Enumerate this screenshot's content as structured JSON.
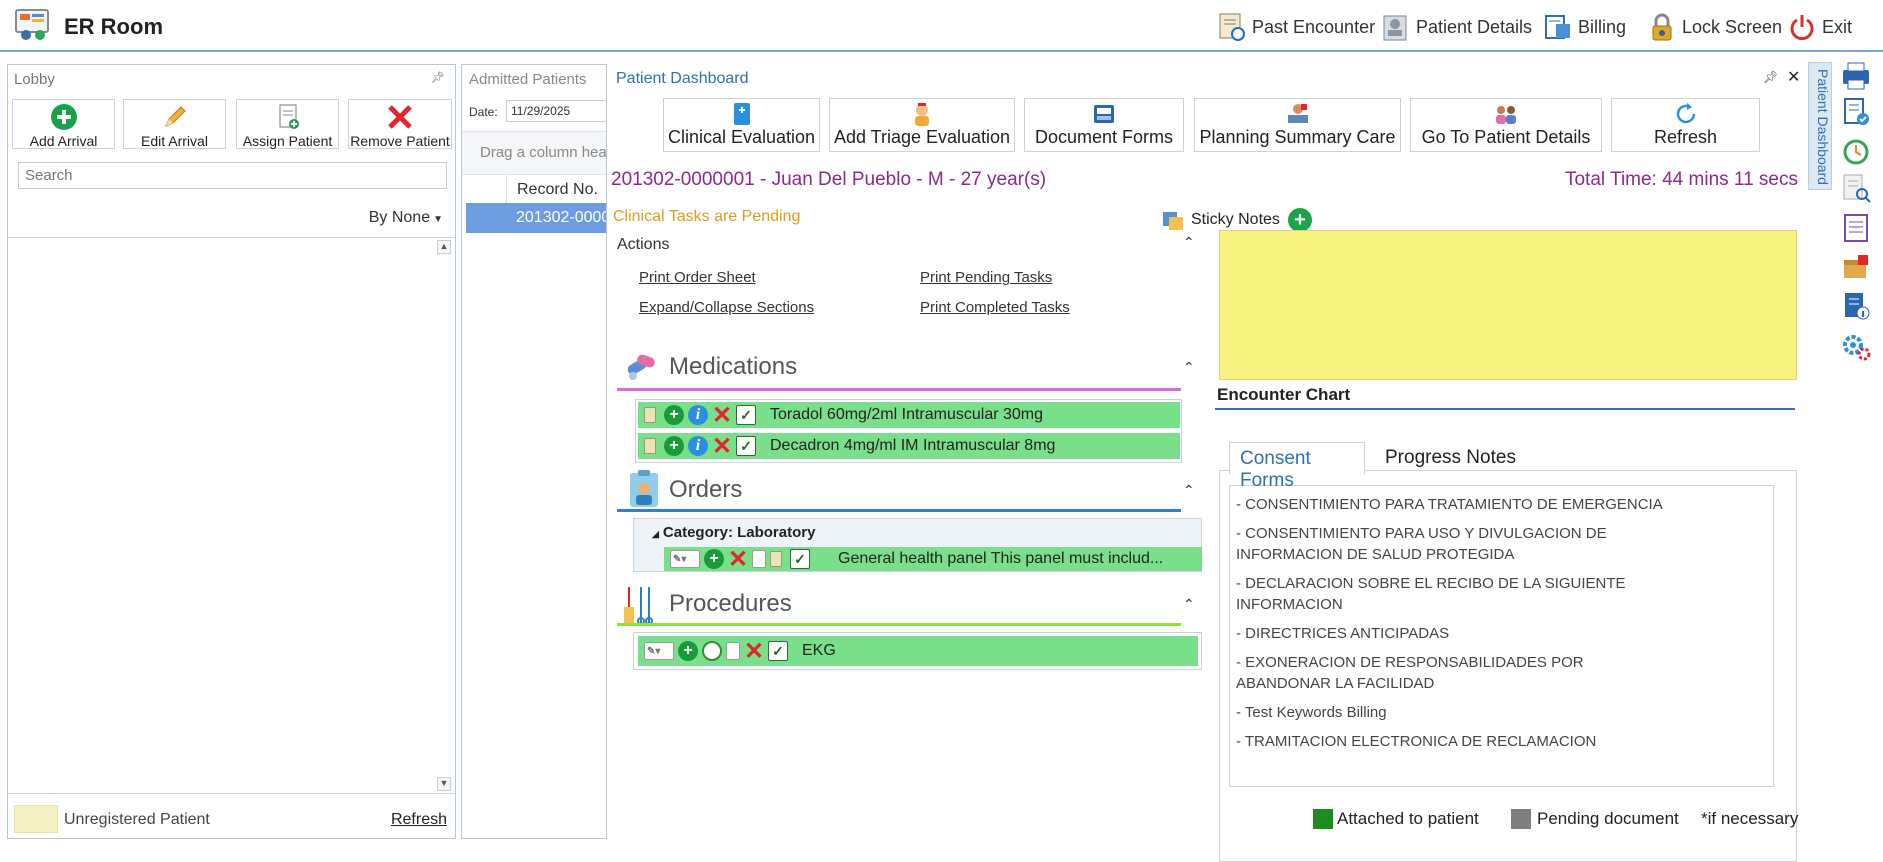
{
  "app": {
    "title": "ER Room"
  },
  "topbar": {
    "past_encounter": "Past Encounter",
    "patient_details": "Patient Details",
    "billing": "Billing",
    "lock_screen": "Lock Screen",
    "exit": "Exit"
  },
  "lobby": {
    "title": "Lobby",
    "add_arrival": "Add Arrival",
    "edit_arrival": "Edit Arrival",
    "assign_patient": "Assign Patient",
    "remove_patient": "Remove Patient",
    "search_placeholder": "Search",
    "sort_label": "By None",
    "legend_label": "Unregistered Patient",
    "refresh": "Refresh"
  },
  "admitted": {
    "title": "Admitted Patients",
    "date_label": "Date:",
    "date_value": "11/29/2025",
    "drag_hint": "Drag a column hea",
    "col_record": "Record No.",
    "row_record": "201302-0000"
  },
  "dashboard": {
    "title": "Patient Dashboard",
    "toolbar": {
      "clinical_evaluation": "Clinical Evaluation",
      "add_triage": "Add Triage Evaluation",
      "document_forms": "Document Forms",
      "planning_summary": "Planning Summary Care",
      "goto_patient": "Go To Patient Details",
      "refresh": "Refresh"
    },
    "patient_banner": "201302-0000001 - Juan Del Pueblo - M - 27 year(s)",
    "total_time": "Total Time: 44 mins 11 secs",
    "pending_message": "Clinical Tasks are Pending",
    "actions": {
      "title": "Actions",
      "print_order_sheet": "Print Order Sheet",
      "print_pending_tasks": "Print Pending Tasks",
      "expand_collapse": "Expand/Collapse Sections",
      "print_completed_tasks": "Print Completed Tasks"
    },
    "medications": {
      "title": "Medications",
      "items": [
        {
          "text": "Toradol 60mg/2ml  Intramuscular  30mg"
        },
        {
          "text": "Decadron 4mg/ml IM  Intramuscular  8mg"
        }
      ]
    },
    "orders": {
      "title": "Orders",
      "category": "Category: Laboratory",
      "items": [
        {
          "text": "General health panel This panel must includ..."
        }
      ]
    },
    "procedures": {
      "title": "Procedures",
      "items": [
        {
          "text": "EKG"
        }
      ]
    },
    "sticky_notes": {
      "label": "Sticky Notes"
    },
    "encounter_chart": {
      "title": "Encounter Chart",
      "tab_consent": "Consent Forms",
      "tab_progress": "Progress Notes",
      "consent_items": [
        "- CONSENTIMIENTO PARA TRATAMIENTO DE EMERGENCIA",
        "- CONSENTIMIENTO PARA USO Y DIVULGACION DE INFORMACION DE SALUD PROTEGIDA",
        "- DECLARACION SOBRE EL RECIBO DE LA SIGUIENTE INFORMACION",
        "- DIRECTRICES ANTICIPADAS",
        "- EXONERACION DE RESPONSABILIDADES POR ABANDONAR LA FACILIDAD",
        "- Test Keywords Billing",
        "- TRAMITACION ELECTRONICA DE RECLAMACION"
      ]
    },
    "legend": {
      "attached": "Attached to patient",
      "pending": "Pending document",
      "if_necessary": "*if necessary"
    }
  },
  "rail": {
    "tab_label": "Patient Dashboard"
  },
  "colors": {
    "accent": "#2f6fb3",
    "banner": "#8a2a8a",
    "pending": "#e19a1c",
    "task_green": "#79df8a",
    "sticky_yellow": "#f8f37f",
    "attached_green": "#1e8c1e",
    "pending_gray": "#7f7f7f"
  }
}
